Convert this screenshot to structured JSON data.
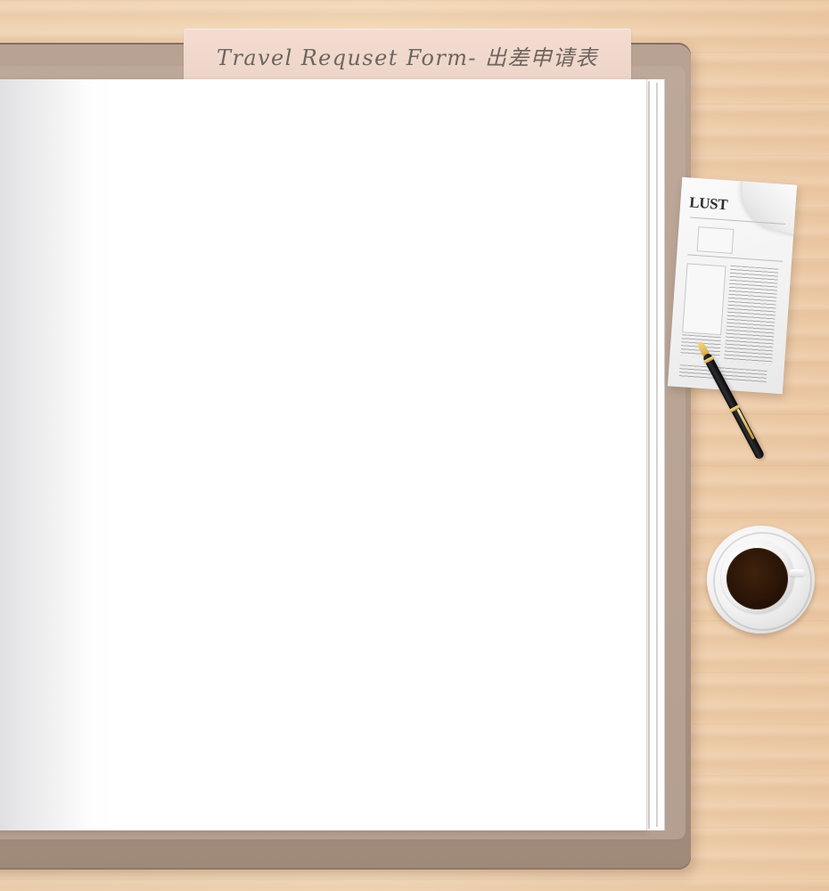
{
  "form": {
    "title": "Travel Requset Form- 出差申请表"
  },
  "newspaper": {
    "headline": "LUST"
  },
  "colors": {
    "desk": "#efd2b1",
    "folder": "#b19b8d",
    "label": "#f1dbcf",
    "paper": "#ffffff",
    "coffee": "#2c1608"
  }
}
